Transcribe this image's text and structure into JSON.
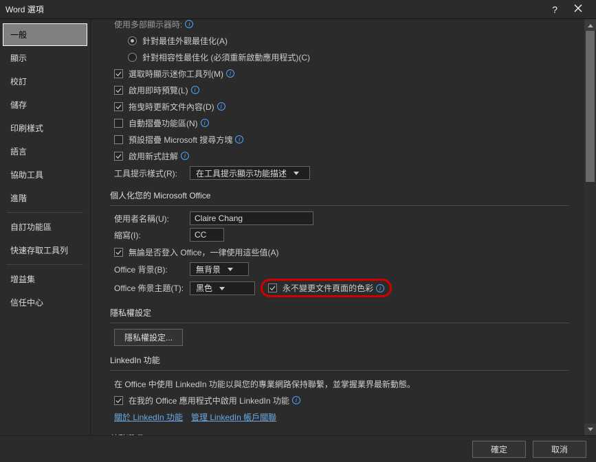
{
  "title": "Word 選項",
  "sidebar": {
    "items": [
      {
        "label": "一般"
      },
      {
        "label": "顯示"
      },
      {
        "label": "校訂"
      },
      {
        "label": "儲存"
      },
      {
        "label": "印刷樣式"
      },
      {
        "label": "語言"
      },
      {
        "label": "協助工具"
      },
      {
        "label": "進階"
      },
      {
        "label": "自訂功能區"
      },
      {
        "label": "快速存取工具列"
      },
      {
        "label": "增益集"
      },
      {
        "label": "信任中心"
      }
    ]
  },
  "pane": {
    "partialLabel": "使用多部顯示器時:",
    "radioA": "針對最佳外觀最佳化(A)",
    "radioC": "針對相容性最佳化 (必須重新啟動應用程式)(C)",
    "chkMini": "選取時顯示迷你工具列(M)",
    "chkLive": "啟用即時預覽(L)",
    "chkDrag": "拖曳時更新文件內容(D)",
    "chkAutoCollapse": "自動摺疊功能區(N)",
    "chkSearchCollapse": "預設摺疊 Microsoft 搜尋方塊",
    "chkNewAnnot": "啟用新式註解",
    "tooltipLabel": "工具提示樣式(R):",
    "tooltipValue": "在工具提示顯示功能描述",
    "personalSection": "個人化您的 Microsoft Office",
    "usernameLabel": "使用者名稱(U):",
    "usernameValue": "Claire Chang",
    "initialsLabel": "縮寫(I):",
    "initialsValue": "CC",
    "chkAlways": "無論是否登入 Office，一律使用這些值(A)",
    "bgLabel": "Office 背景(B):",
    "bgValue": "無背景",
    "themeLabel": "Office 佈景主題(T):",
    "themeValue": "黑色",
    "chkNeverChange": "永不變更文件頁面的色彩",
    "privacySection": "隱私權設定",
    "privacyBtn": "隱私權設定...",
    "linkedinSection": "LinkedIn 功能",
    "linkedinText": "在 Office 中使用 LinkedIn 功能以與您的專業網路保持聯繫，並掌握業界最新動態。",
    "chkLinkedin": "在我的 Office 應用程式中啟用 LinkedIn 功能",
    "linkAbout": "關於 LinkedIn 功能",
    "linkManage": "管理 LinkedIn 帳戶關聯",
    "startupSection": "啟動選項"
  },
  "footer": {
    "ok": "確定",
    "cancel": "取消"
  }
}
